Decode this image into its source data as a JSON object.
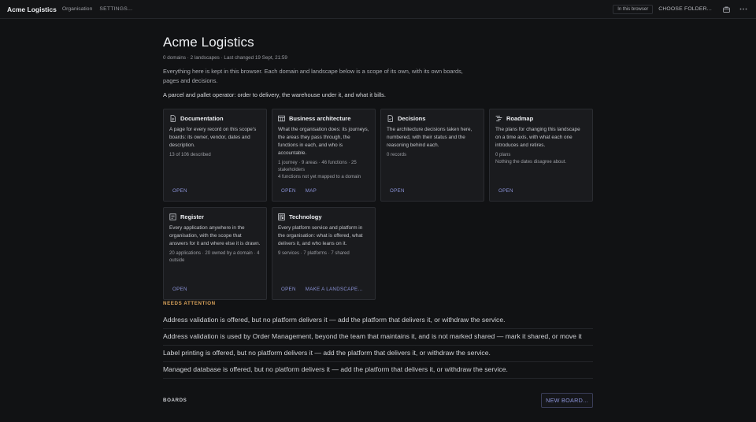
{
  "topbar": {
    "brand": "Acme Logistics",
    "nav_org": "Organisation",
    "nav_settings": "SETTINGS...",
    "storage_pill": "In this browser",
    "choose_folder": "CHOOSE FOLDER...",
    "icons": [
      "briefcase-icon",
      "more-icon"
    ]
  },
  "page": {
    "title": "Acme Logistics",
    "meta": "0 domains · 2 landscapes · Last changed 19 Sept, 21:59",
    "intro": "Everything here is kept in this browser. Each domain and landscape below is a scope of its own, with its own boards, pages and decisions.",
    "tagline": "A parcel and pallet operator: order to delivery, the warehouse under it, and what it bills."
  },
  "cards": [
    {
      "icon": "document-icon",
      "title": "Documentation",
      "desc": "A page for every record on this scope's boards: its owner, vendor, dates and description.",
      "stats": [
        "13 of 106 described"
      ],
      "actions": [
        "OPEN"
      ]
    },
    {
      "icon": "grid-icon",
      "title": "Business architecture",
      "desc": "What the organisation does: its journeys, the areas they pass through, the functions in each, and who is accountable.",
      "stats": [
        "1 journey · 9 areas · 46 functions · 25 stakeholders",
        "4 functions not yet mapped to a domain"
      ],
      "actions": [
        "OPEN",
        "MAP"
      ]
    },
    {
      "icon": "decision-icon",
      "title": "Decisions",
      "desc": "The architecture decisions taken here, numbered, with their status and the reasoning behind each.",
      "stats": [
        "0 records"
      ],
      "actions": [
        "OPEN"
      ]
    },
    {
      "icon": "roadmap-icon",
      "title": "Roadmap",
      "desc": "The plans for changing this landscape on a time axis, with what each one introduces and retires.",
      "stats": [
        "0 plans",
        "Nothing the dates disagree about."
      ],
      "actions": [
        "OPEN"
      ]
    },
    {
      "icon": "register-icon",
      "title": "Register",
      "desc": "Every application anywhere in the organisation, with the scope that answers for it and where else it is drawn.",
      "stats": [
        "20 applications · 20 owned by a domain · 4 outside"
      ],
      "actions": [
        "OPEN"
      ]
    },
    {
      "icon": "technology-icon",
      "title": "Technology",
      "desc": "Every platform service and platform in the organisation: what is offered, what delivers it, and who leans on it.",
      "stats": [
        "9 services · 7 platforms · 7 shared"
      ],
      "actions": [
        "OPEN",
        "MAKE A LANDSCAPE..."
      ]
    }
  ],
  "attention": {
    "label": "NEEDS ATTENTION",
    "items": [
      "Address validation is offered, but no platform delivers it — add the platform that delivers it, or withdraw the service.",
      "Address validation is used by Order Management, beyond the team that maintains it, and is not marked shared — mark it shared, or move it",
      "Label printing is offered, but no platform delivers it — add the platform that delivers it, or withdraw the service.",
      "Managed database is offered, but no platform delivers it — add the platform that delivers it, or withdraw the service."
    ]
  },
  "boards": {
    "label": "BOARDS",
    "new_board": "NEW BOARD..."
  }
}
